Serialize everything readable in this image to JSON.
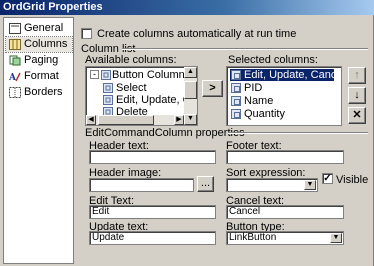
{
  "window": {
    "title": "OrdGrid Properties"
  },
  "sidebar": {
    "items": [
      {
        "label": "General",
        "icon": "general-page-icon"
      },
      {
        "label": "Columns",
        "icon": "columns-icon",
        "selected": true
      },
      {
        "label": "Paging",
        "icon": "paging-icon"
      },
      {
        "label": "Format",
        "icon": "format-icon"
      },
      {
        "label": "Borders",
        "icon": "borders-icon"
      }
    ]
  },
  "columns": {
    "auto_generate_label": "Create columns automatically at run time",
    "auto_generate_checked": false,
    "column_list_label": "Column list",
    "available_label": "Available columns:",
    "available_tree": [
      {
        "label": "Button Column",
        "expander": "-"
      },
      {
        "label": "Select"
      },
      {
        "label": "Edit, Update, Canc"
      },
      {
        "label": "Delete"
      }
    ],
    "add_button": ">",
    "selected_label": "Selected columns:",
    "selected_items": [
      "Edit, Update, Cancel",
      "PID",
      "Name",
      "Quantity"
    ],
    "selected_index": 0,
    "move_up_glyph": "↑",
    "move_down_glyph": "↓",
    "delete_glyph": "✕"
  },
  "properties": {
    "section_label": "EditCommandColumn properties",
    "header_text_label": "Header text:",
    "header_text_value": "",
    "footer_text_label": "Footer text:",
    "footer_text_value": "",
    "header_image_label": "Header image:",
    "header_image_value": "",
    "browse_button": "...",
    "sort_expression_label": "Sort expression:",
    "sort_expression_value": "",
    "visible_label": "Visible",
    "visible_checked": true,
    "edit_text_label": "Edit Text:",
    "edit_text_value": "Edit",
    "cancel_text_label": "Cancel text:",
    "cancel_text_value": "Cancel",
    "update_text_label": "Update text:",
    "update_text_value": "Update",
    "button_type_label": "Button type:",
    "button_type_value": "LinkButton"
  }
}
